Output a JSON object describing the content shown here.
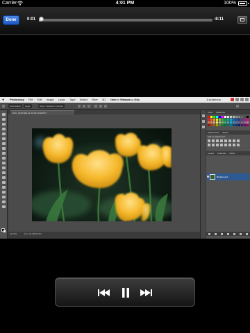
{
  "status_bar": {
    "carrier": "Carrier",
    "time": "4:01 PM",
    "battery": "100%"
  },
  "player": {
    "done_label": "Done",
    "elapsed": "0:01",
    "remaining": "-8:11",
    "progress": 0.01
  },
  "photoshop": {
    "menubar": {
      "items": [
        "Photoshop",
        "File",
        "Edit",
        "Image",
        "Layer",
        "Type",
        "Select",
        "Filter",
        "3D",
        "View",
        "Window",
        "Help"
      ],
      "app_title": "Adobe Photoshop CC",
      "user": "A Anderson"
    },
    "options_bar": {
      "mode_label": "Auto-Select:",
      "mode_value": "Layer",
      "transform_label": "Show Transform Controls"
    },
    "document_tab": "DSC_0420.NEF @ 33.3% (RGB/16*)",
    "status": {
      "zoom": "33.33%",
      "doc_size": "Doc: 34.9M/34.9M"
    },
    "panels": {
      "color_tabs": [
        "Color",
        "Swatches"
      ],
      "adjustments_tabs": [
        "Adjustments",
        "Styles"
      ],
      "adjustments_title": "Add an adjustment",
      "layers_tabs": [
        "Layers",
        "Channels",
        "Paths"
      ],
      "layer_name": "Background"
    },
    "colors": {
      "swatches": [
        "#ff0000",
        "#ffff00",
        "#00ff00",
        "#00ffff",
        "#0000ff",
        "#ff00ff",
        "#ffffff",
        "#e6e6e6",
        "#cccccc",
        "#b3b3b3",
        "#999999",
        "#808080",
        "#666666",
        "#4d4d4d",
        "#000000",
        "#ed1c24",
        "#f26522",
        "#f7941d",
        "#fff200",
        "#8dc63f",
        "#39b54a",
        "#00a651",
        "#00a99d",
        "#00aeef",
        "#0072bc",
        "#0054a6",
        "#2e3192",
        "#662d91",
        "#92278f",
        "#ec008c",
        "#f26c4f",
        "#f68e56",
        "#fbaf5d",
        "#fff568",
        "#acd373",
        "#7cc576",
        "#3bb878",
        "#1abbb4",
        "#00bff3",
        "#438ccb",
        "#5574b9",
        "#605ca8",
        "#855fa8",
        "#a763a8",
        "#f06eaa",
        "#9e0b0f",
        "#a0410d",
        "#a36209",
        "#aba000",
        "#598527",
        "#1a7b30",
        "#007236",
        "#00746b",
        "#0076a3",
        "#004b80",
        "#003471",
        "#1b1464",
        "#440e62",
        "#630460",
        "#9e005d"
      ]
    }
  }
}
